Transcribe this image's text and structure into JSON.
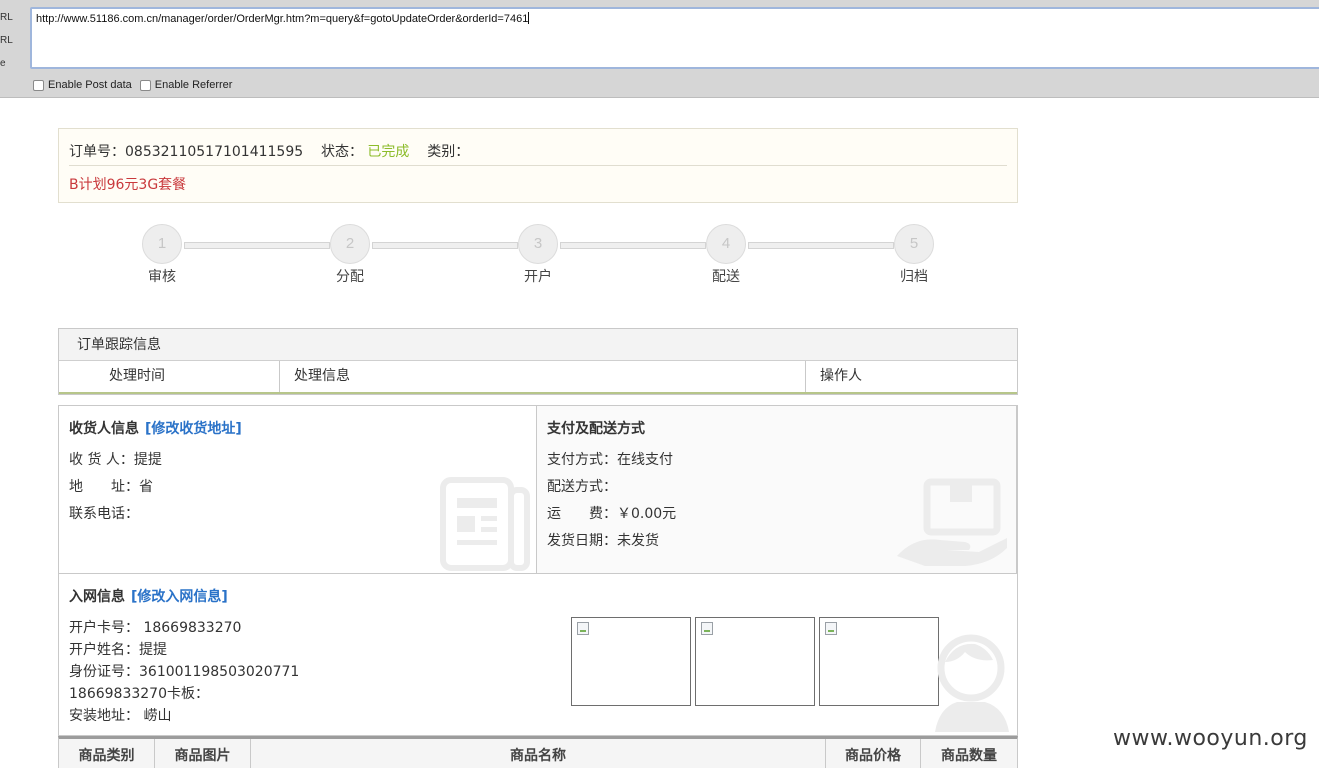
{
  "toolbar": {
    "side_labels": [
      "RL",
      "RL",
      "e"
    ],
    "url": "http://www.51186.com.cn/manager/order/OrderMgr.htm?m=query&f=gotoUpdateOrder&orderId=7461",
    "enable_post_label": "Enable Post data",
    "enable_referrer_label": "Enable Referrer"
  },
  "order": {
    "number_label": "订单号：",
    "number": "08532110517101411595",
    "status_label": "状态：",
    "status": "已完成",
    "category_label": "类别：",
    "plan": "B计划96元3G套餐"
  },
  "steps": [
    {
      "num": "1",
      "label": "审核"
    },
    {
      "num": "2",
      "label": "分配"
    },
    {
      "num": "3",
      "label": "开户"
    },
    {
      "num": "4",
      "label": "配送"
    },
    {
      "num": "5",
      "label": "归档"
    }
  ],
  "tracking": {
    "title": "订单跟踪信息",
    "columns": [
      "处理时间",
      "处理信息",
      "操作人"
    ]
  },
  "receiver": {
    "title": "收货人信息",
    "edit_link": "[修改收货地址]",
    "name_label": "收 货 人：",
    "name": "提提",
    "address_label": "地　　址：",
    "address": "省",
    "phone_label": "联系电话："
  },
  "payment": {
    "title": "支付及配送方式",
    "method_label": "支付方式：",
    "method": "在线支付",
    "delivery_label": "配送方式：",
    "fee_label": "运　　费：",
    "fee": "￥0.00元",
    "ship_date_label": "发货日期：",
    "ship_date": "未发货"
  },
  "network": {
    "title": "入网信息",
    "edit_link": "[修改入网信息]",
    "card_label": "开户卡号：",
    "card": "18669833270",
    "name_label": "开户姓名：",
    "name": "提提",
    "id_label": "身份证号：",
    "id": "361001198503020771",
    "board": "18669833270卡板：",
    "install_label": "安装地址：",
    "install": "崂山"
  },
  "goods": {
    "columns": [
      "商品类别",
      "商品图片",
      "商品名称",
      "商品价格",
      "商品数量"
    ]
  },
  "watermark": "www.wooyun.org",
  "colors": {
    "status": "#8cbc2a",
    "plan": "#c9393c",
    "link": "#2a72c8"
  }
}
